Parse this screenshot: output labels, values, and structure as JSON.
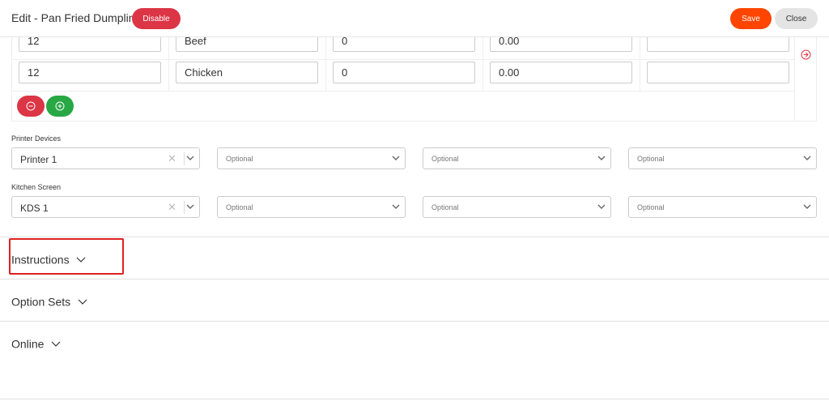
{
  "header": {
    "title": "Edit - Pan Fried Dumpling",
    "disable_label": "Disable",
    "save_label": "Save",
    "close_label": "Close"
  },
  "variants": [
    {
      "c1": "12",
      "c2": "Beef",
      "c3": "0",
      "c4": "0.00",
      "c5": ""
    },
    {
      "c1": "12",
      "c2": "Chicken",
      "c3": "0",
      "c4": "0.00",
      "c5": ""
    }
  ],
  "printer_devices": {
    "label": "Printer Devices",
    "selected": "Printer 1",
    "placeholders": [
      "Optional",
      "Optional",
      "Optional"
    ]
  },
  "kitchen_screen": {
    "label": "Kitchen Screen",
    "selected": "KDS 1",
    "placeholders": [
      "Optional",
      "Optional",
      "Optional"
    ]
  },
  "sections": {
    "instructions": "Instructions",
    "option_sets": "Option Sets",
    "online": "Online"
  },
  "colors": {
    "danger": "#dc3545",
    "save": "#ff4500",
    "success": "#28a745",
    "highlight": "#e02020"
  },
  "icons": {
    "remove_row": "minus-circle-icon",
    "add_row": "plus-circle-icon",
    "row_action": "arrow-right-circle-icon",
    "dropdown": "chevron-down-icon",
    "clear": "clear-x-icon"
  }
}
